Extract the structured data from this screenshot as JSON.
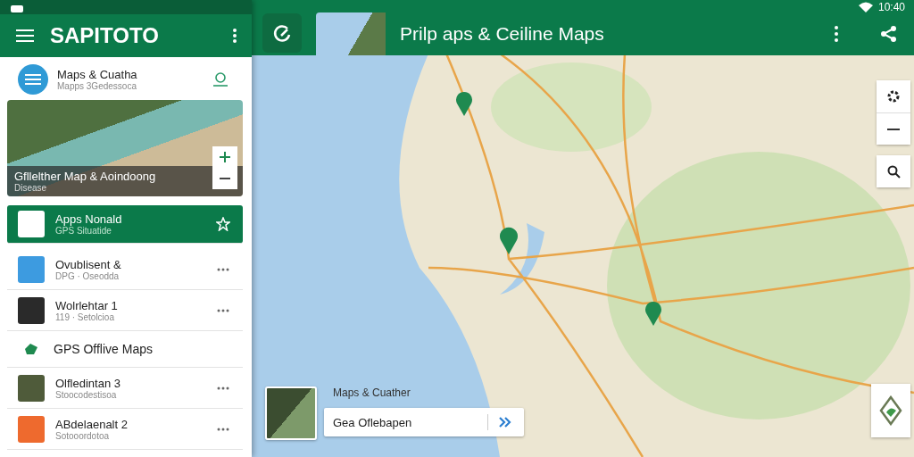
{
  "status_bar": {
    "time": "10:40"
  },
  "panel": {
    "title": "SAPITOTO",
    "header_card": {
      "title": "Maps & Cuatha",
      "subtitle": "Mapps 3Gedessoca"
    },
    "photo_card": {
      "caption": "Gfllelther Map & Aoindoong",
      "subcaption": "Disease"
    },
    "rows": [
      {
        "kind": "item",
        "title": "Apps Nonald",
        "subtitle": "GPS Situatide",
        "selected": true
      },
      {
        "kind": "item",
        "title": "Ovublisent &",
        "subtitle": "DPG · Oseodda",
        "selected": false
      },
      {
        "kind": "item",
        "title": "Wolrlehtar 1",
        "subtitle": "119 · Setolcioa",
        "selected": false
      },
      {
        "kind": "heading",
        "title": "GPS Offlive Maps"
      },
      {
        "kind": "item",
        "title": "Olfledintan 3",
        "subtitle": "Stoocodestisoa",
        "selected": false
      },
      {
        "kind": "item",
        "title": "ABdelaenalt 2",
        "subtitle": "Sotooordotoa",
        "selected": false
      }
    ]
  },
  "top_bar": {
    "title": "Prilp aps & Ceiline Maps"
  },
  "bottom_card": {
    "label": "Maps & Cuather",
    "search_value": "Gea Oflebapen"
  }
}
